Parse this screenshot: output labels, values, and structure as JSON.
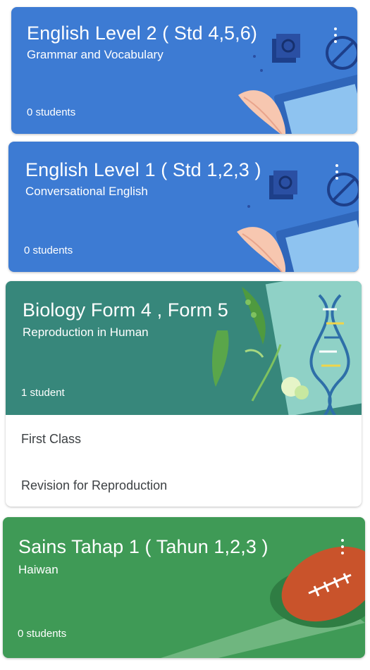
{
  "classes": [
    {
      "title": "English Level 2 ( Std 4,5,6)",
      "subtitle": "Grammar and Vocabulary",
      "count": "0 students",
      "menu_icon": "more-vert-icon",
      "color": "#3d7bd3"
    },
    {
      "title": "English Level 1 ( Std 1,2,3 )",
      "subtitle": "Conversational English",
      "count": "0 students",
      "menu_icon": "more-vert-icon",
      "color": "#3d7bd3"
    },
    {
      "title": "Biology Form 4 , Form  5",
      "subtitle": "Reproduction in Human",
      "count": "1 student",
      "menu_icon": "more-vert-icon",
      "color": "#37877b",
      "items": [
        "First Class",
        "Revision for Reproduction"
      ]
    },
    {
      "title": "Sains Tahap 1 ( Tahun 1,2,3 )",
      "subtitle": "Haiwan",
      "count": "0 students",
      "menu_icon": "more-vert-icon",
      "color": "#3f9a56"
    }
  ]
}
